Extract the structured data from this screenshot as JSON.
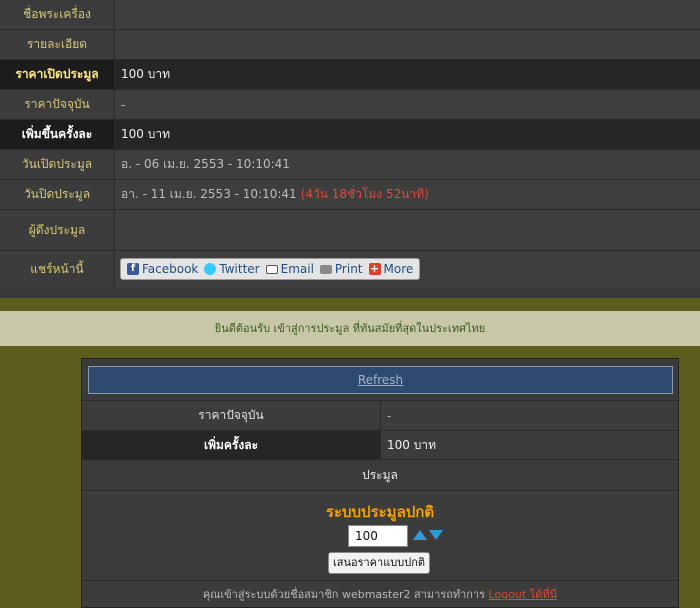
{
  "details": {
    "item_name": {
      "label": "ชื่อพระเครื่อง",
      "value": ""
    },
    "description": {
      "label": "รายละเอียด",
      "value": ""
    },
    "start_price": {
      "label": "ราคาเปิดประมูล",
      "value": "100 บาท"
    },
    "current_price": {
      "label": "ราคาปัจจุบัน",
      "value": "-"
    },
    "increment": {
      "label": "เพิ่มขึ้นครั้งละ",
      "value": "100 บาท"
    },
    "open_date": {
      "label": "วันเปิดประมูล",
      "value": "อ. - 06 เม.ย. 2553 - 10:10:41"
    },
    "close_date": {
      "label": "วันปิดประมูล",
      "value": "อา. - 11 เม.ย. 2553 - 10:10:41",
      "remaining": "(4วัน 18ชั่วโมง 52นาที)"
    },
    "bidder": {
      "label": "ผู้ดึงประมูล",
      "value": ""
    },
    "share": {
      "label": "แชร์หน้านี้"
    }
  },
  "share_bar": {
    "facebook": "Facebook",
    "twitter": "Twitter",
    "email": "Email",
    "print": "Print",
    "more": "More"
  },
  "welcome_text": "ยินดีต้อนรับ เข้าสู่การประมูล ที่ทันสมัยที่สุดในประเทศไทย",
  "panel": {
    "refresh_label": "Refresh",
    "current_price_label": "ราคาปัจจุบัน",
    "current_price_value": "-",
    "increment_label": "เพิ่มครั้งละ",
    "increment_value": "100 บาท",
    "bid_header": "ประมูล",
    "bid_system_title": "ระบบประมูลปกติ",
    "bid_amount": "100",
    "submit_label": "เสนอราคาแบบปกติ",
    "footer_text": "คุณเข้าสู่ระบบด้วยชื่อสมาชิก webmaster2 สามารถทำการ",
    "logout_label": "Logout ได้ที่นี่"
  },
  "colors": {
    "olive": "#5d5d1d",
    "label_gold": "#d8c878",
    "bid_title": "#f0a000",
    "refresh_bg": "#2e4a6e",
    "warning_red": "#d84d40"
  }
}
